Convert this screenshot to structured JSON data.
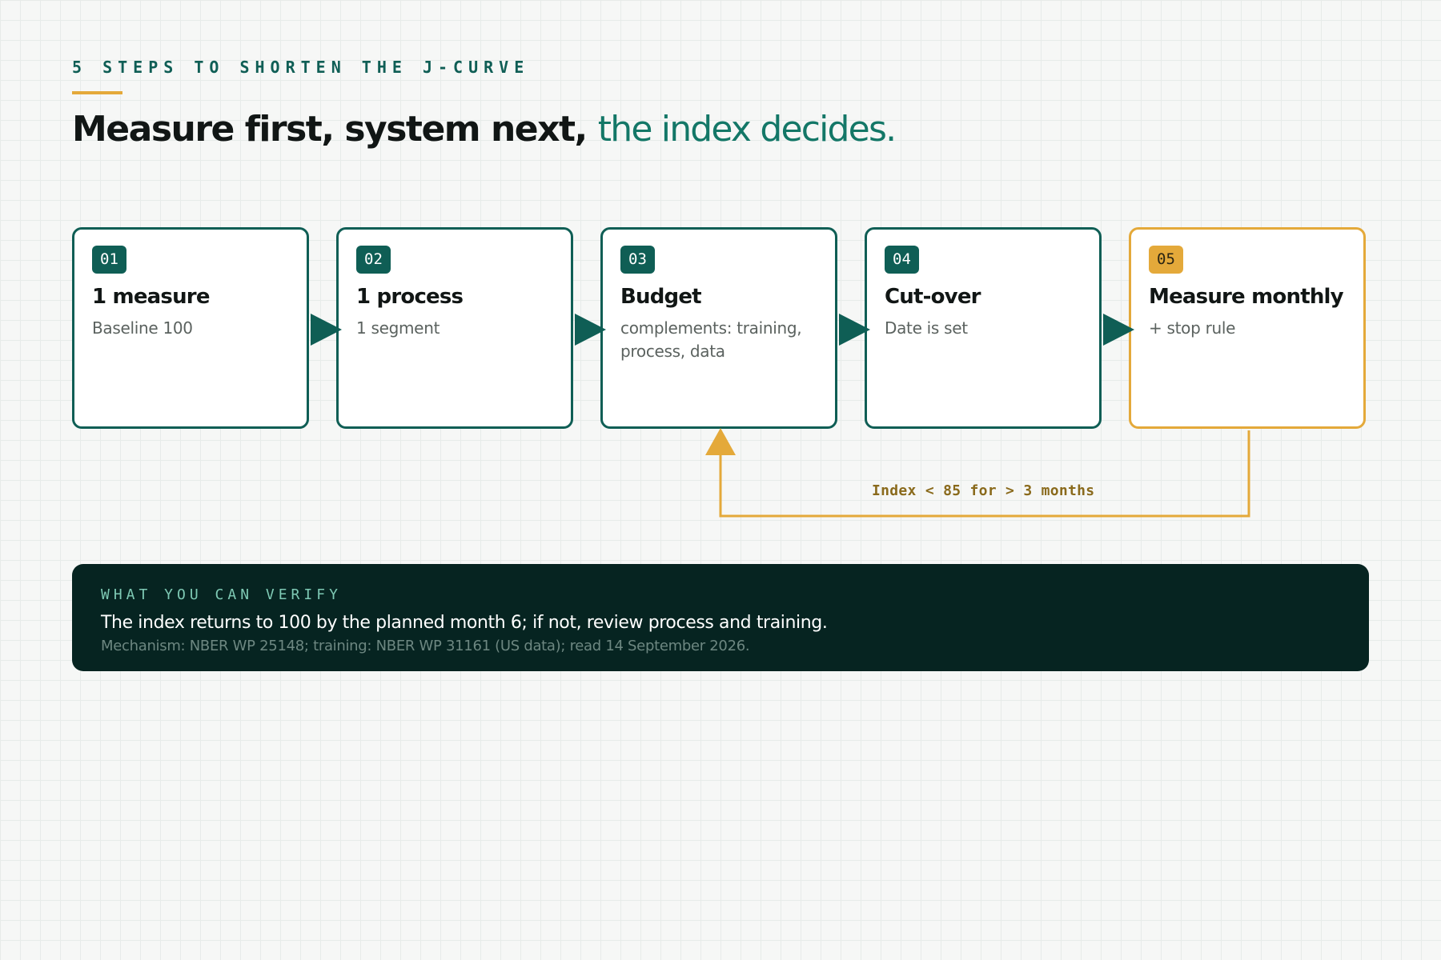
{
  "header": {
    "eyebrow": "5 STEPS TO SHORTEN THE J-CURVE",
    "title_strong": "Measure first, system next,",
    "title_accent": "the index decides."
  },
  "steps": [
    {
      "number": "01",
      "title": "1 measure",
      "subtitle": "Baseline 100"
    },
    {
      "number": "02",
      "title": "1 process",
      "subtitle": "1 segment"
    },
    {
      "number": "03",
      "title": "Budget",
      "subtitle": "complements: training, process, data"
    },
    {
      "number": "04",
      "title": "Cut-over",
      "subtitle": "Date is set"
    },
    {
      "number": "05",
      "title": "Measure monthly",
      "subtitle": "+ stop rule"
    }
  ],
  "loop": {
    "label": "Index < 85 for > 3 months",
    "from_step": "05",
    "to_step": "03"
  },
  "verify": {
    "kicker": "WHAT YOU CAN VERIFY",
    "main": "The index returns to 100 by the planned month 6; if not, review process and training.",
    "note": "Mechanism: NBER WP 25148; training: NBER WP 31161 (US data); read 14 September 2026."
  },
  "colors": {
    "teal": "#0f5e55",
    "accent_teal": "#137767",
    "amber": "#e4a93a",
    "dark_panel": "#062421"
  }
}
